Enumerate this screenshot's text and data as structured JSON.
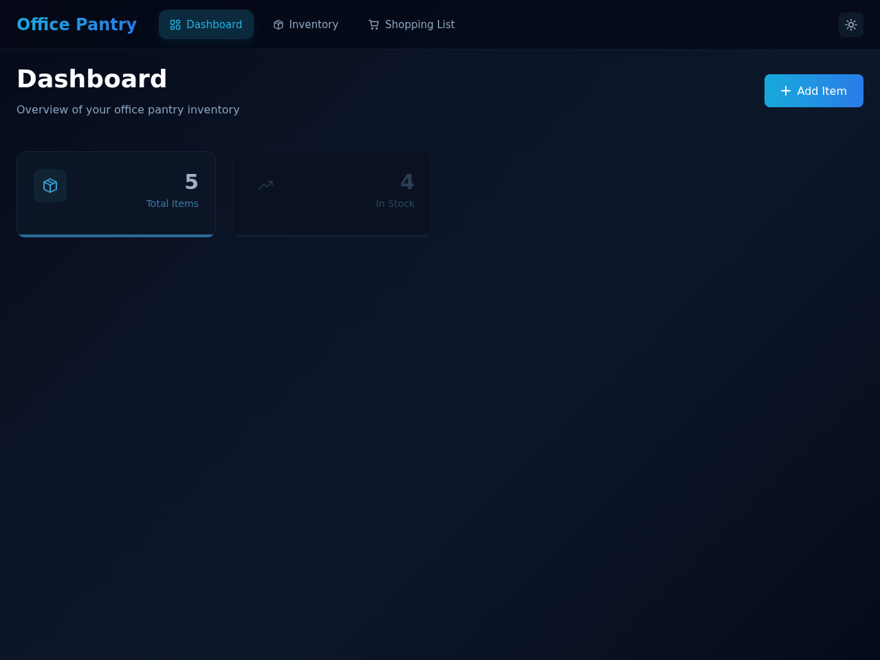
{
  "header": {
    "logo": "Office Pantry",
    "tabs": [
      {
        "label": "Dashboard",
        "kind": "grid",
        "selected": true
      },
      {
        "label": "Inventory",
        "kind": "box",
        "selected": false
      },
      {
        "label": "Shopping List",
        "kind": "cart",
        "selected": false
      }
    ]
  },
  "page": {
    "title": "Dashboard",
    "subtitle": "Overview of your office pantry inventory",
    "add_button": "Add Item"
  },
  "stats": [
    {
      "value": "5",
      "label": "Total Items",
      "kind": "box",
      "dimmed": false
    },
    {
      "value": "4",
      "label": "In Stock",
      "kind": "trend",
      "dimmed": true
    }
  ]
}
